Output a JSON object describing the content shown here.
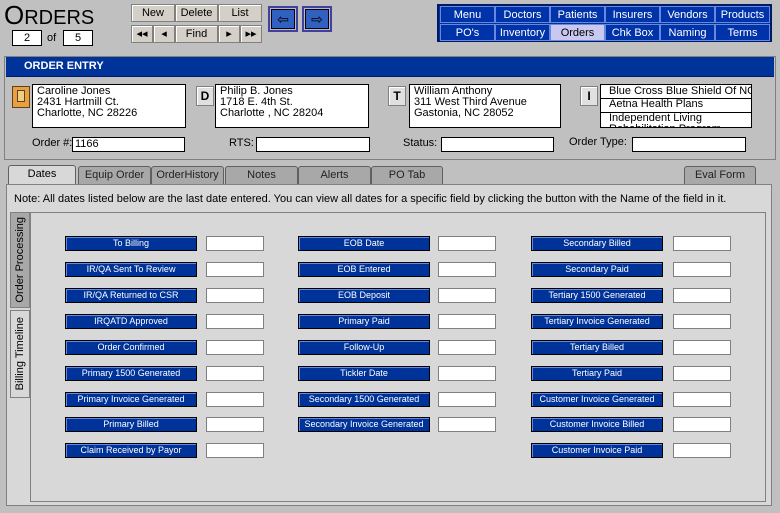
{
  "window": {
    "title_first": "O",
    "title_rest": "RDERS"
  },
  "record_nav": {
    "current": "2",
    "of_label": "of",
    "total": "5"
  },
  "toolbar": {
    "new": "New",
    "delete": "Delete",
    "list": "List",
    "first": "◂◂",
    "prev": "◂",
    "find": "Find",
    "next": "▸",
    "last": "▸▸"
  },
  "nav_arrows": {
    "back": "⇦",
    "forward": "⇨"
  },
  "menu": {
    "row1": [
      "Menu",
      "Doctors",
      "Patients",
      "Insurers",
      "Vendors",
      "Products"
    ],
    "row2": [
      "PO's",
      "Inventory",
      "Orders",
      "Chk Box",
      "Naming",
      "Terms"
    ],
    "active": "Orders"
  },
  "order_entry": {
    "header": "ORDER ENTRY",
    "patient": {
      "line1": "Caroline Jones",
      "line2": "2431 Hartmill Ct.",
      "line3": "Charlotte, NC 28226"
    },
    "doctor": {
      "letter": "D",
      "line1": "Philip B. Jones",
      "line2": "1718 E. 4th St.",
      "line3": "Charlotte , NC 28204"
    },
    "therapist": {
      "letter": "T",
      "line1": "William Anthony",
      "line2": "311 West Third Avenue",
      "line3": "Gastonia, NC 28052"
    },
    "insurance": {
      "letter": "I",
      "items": [
        "Blue Cross Blue Shield Of NC",
        "Aetna Health Plans",
        "Independent Living Rehabilitation Program"
      ]
    },
    "order_label": "Order #:",
    "order_value": "1166",
    "rts_label": "RTS:",
    "rts_value": "",
    "status_label": "Status:",
    "status_value": "",
    "order_type_label": "Order Type:",
    "order_type_value": ""
  },
  "tabs": [
    "Dates",
    "Equip Order",
    "OrderHistory",
    "Notes",
    "Alerts",
    "PO Tab",
    "Eval Form"
  ],
  "active_tab": "Dates",
  "note": "Note:  All dates listed below are the last date entered.  You can view all dates for a specific field by clicking the button with the Name of the field in it.",
  "side_tabs": [
    "Order Processing",
    "Billing Timeline"
  ],
  "dates": {
    "col1": [
      "To Billing",
      "IR/QA Sent To Review",
      "IR/QA Returned to CSR",
      "IRQATD Approved",
      "Order Confirmed",
      "Primary 1500 Generated",
      "Primary Invoice Generated",
      "Primary Billed",
      "Claim Received by Payor"
    ],
    "col2": [
      "EOB Date",
      "EOB Entered",
      "EOB Deposit",
      "Primary Paid",
      "Follow-Up",
      "Tickler Date",
      "Secondary 1500 Generated",
      "Secondary Invoice Generated"
    ],
    "col3": [
      "Secondary Billed",
      "Secondary Paid",
      "Tertiary 1500 Generated",
      "Tertiary Invoice Generated",
      "Tertiary Billed",
      "Tertiary Paid",
      "Customer Invoice Generated",
      "Customer Invoice Billed",
      "Customer Invoice Paid"
    ]
  }
}
